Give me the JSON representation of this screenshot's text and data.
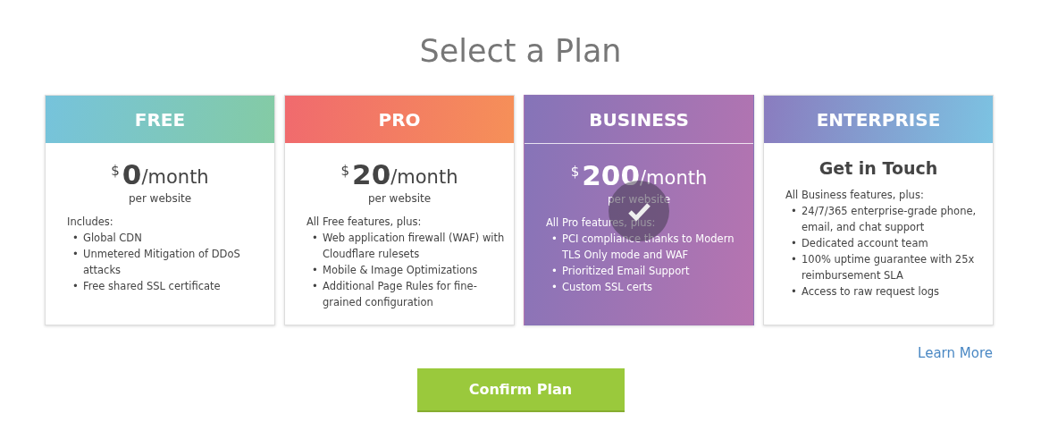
{
  "title": "Select a Plan",
  "plans": [
    {
      "name": "FREE",
      "color": "#76c3dc",
      "selected": false,
      "kind": "price",
      "currency": "$",
      "amount": "0",
      "period": "/month",
      "unit": "per website",
      "intro": "Includes:",
      "features": [
        {
          "bullet": "•",
          "text": "Global CDN"
        },
        {
          "bullet": "•",
          "text": "Unmetered Mitigation of DDoS attacks"
        },
        {
          "bullet": "•",
          "text": "Free shared SSL certificate"
        }
      ]
    },
    {
      "name": "PRO",
      "color": "#f06a6e",
      "selected": false,
      "kind": "price",
      "currency": "$",
      "amount": "20",
      "period": "/month",
      "unit": "per website",
      "intro": "All Free features, plus:",
      "features": [
        {
          "bullet": "•",
          "text": "Web application firewall (WAF) with Cloudflare rulesets"
        },
        {
          "bullet": "•",
          "text": "Mobile & Image Optimizations"
        },
        {
          "bullet": "•",
          "text": "Additional Page Rules for fine-grained configuration"
        }
      ]
    },
    {
      "name": "BUSINESS",
      "color": "#8574b8",
      "selected": true,
      "kind": "price",
      "currency": "$",
      "amount": "200",
      "period": "/month",
      "unit": "per website",
      "intro": "All Pro features, plus:",
      "features": [
        {
          "bullet": "•",
          "text": "PCI compliance thanks to Modern TLS Only mode and WAF"
        },
        {
          "bullet": "•",
          "text": "Prioritized Email Support"
        },
        {
          "bullet": "•",
          "text": "Custom SSL certs"
        }
      ]
    },
    {
      "name": "ENTERPRISE",
      "color": "#8a7cbf",
      "selected": false,
      "kind": "contact",
      "heading": "Get in Touch",
      "intro": "All Business features, plus:",
      "features": [
        {
          "bullet": "•",
          "text": "24/7/365 enterprise-grade phone, email, and chat support"
        },
        {
          "bullet": "•",
          "text": "Dedicated account team"
        },
        {
          "bullet": "•",
          "text": "100% uptime guarantee with 25x reimbursement SLA"
        },
        {
          "bullet": "•",
          "text": "Access to raw request logs"
        }
      ]
    }
  ],
  "learn_more": "Learn More",
  "confirm": "Confirm Plan"
}
